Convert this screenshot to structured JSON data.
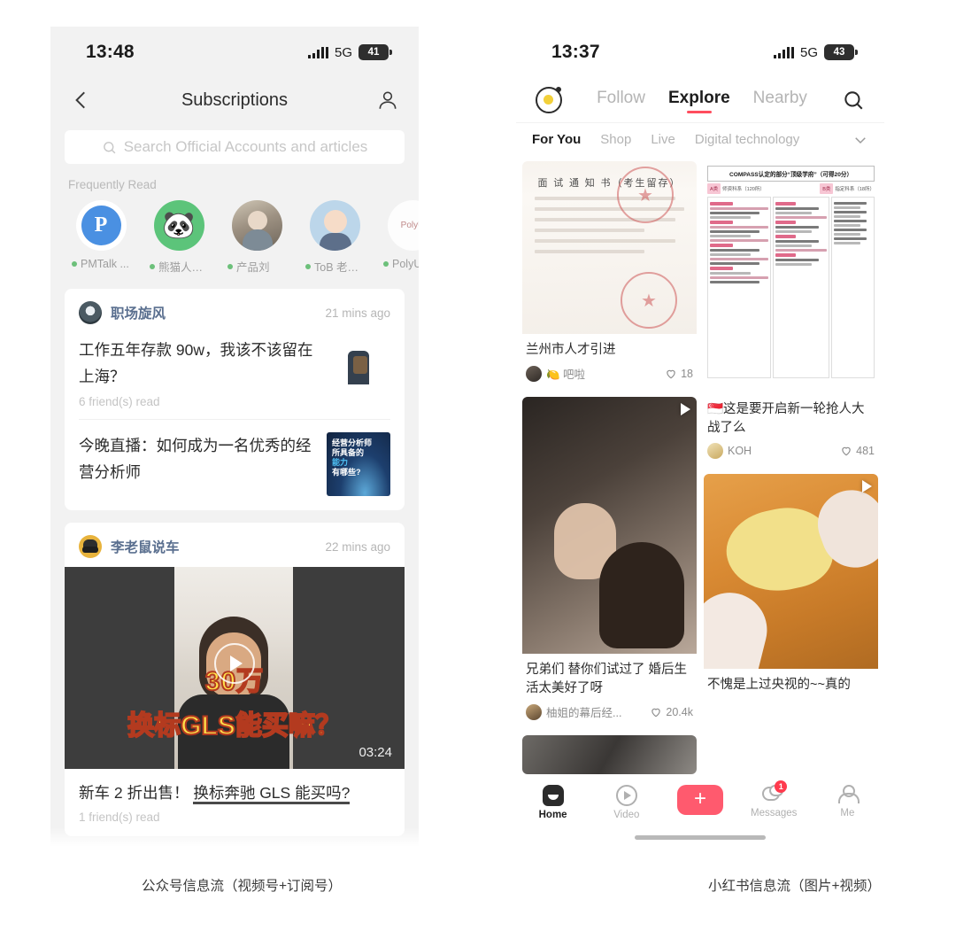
{
  "left_phone": {
    "status": {
      "time": "13:48",
      "network": "5G",
      "battery": "41"
    },
    "nav": {
      "title": "Subscriptions",
      "back_icon": "chevron-left-icon",
      "profile_icon": "person-icon"
    },
    "search": {
      "placeholder": "Search Official Accounts and articles",
      "icon": "search-icon"
    },
    "frequently_read": {
      "label": "Frequently Read",
      "items": [
        {
          "name": "PMTalk ...",
          "avatar": "pmtalk-logo"
        },
        {
          "name": "熊猫人运...",
          "avatar": "panda-logo"
        },
        {
          "name": "产品刘",
          "avatar": "woman-photo"
        },
        {
          "name": "ToB 老人家",
          "avatar": "man-illustration"
        },
        {
          "name": "PolyU",
          "avatar": "polyu-logo"
        }
      ]
    },
    "cards": [
      {
        "account": "职场旋风",
        "time": "21 mins ago",
        "articles": [
          {
            "title": "工作五年存款 90w，我该不该留在上海？",
            "sub": "6 friend(s) read",
            "thumb": "street-photo"
          },
          {
            "title": "今晚直播：如何成为一名优秀的经营分析师",
            "thumb": "live-poster",
            "thumb_text_1": "经营分析师",
            "thumb_text_2": "所具备的",
            "thumb_text_hl": "能力",
            "thumb_text_3": "有哪些?"
          }
        ]
      },
      {
        "account": "李老鼠说车",
        "time": "22 mins ago",
        "video": {
          "caption_line1": "30万",
          "caption_line2": "换标GLS能买嘛？",
          "duration": "03:24",
          "play_icon": "play-circle-icon"
        },
        "title_plain": "新车 2 折出售！ ",
        "title_underlined": "换标奔驰 GLS 能买吗?",
        "sub": "1 friend(s) read"
      }
    ]
  },
  "right_phone": {
    "status": {
      "time": "13:37",
      "network": "5G",
      "battery": "43"
    },
    "top": {
      "logo_icon": "xiaohongshu-logo-icon",
      "search_icon": "search-icon",
      "tabs": [
        {
          "label": "Follow",
          "active": false
        },
        {
          "label": "Explore",
          "active": true
        },
        {
          "label": "Nearby",
          "active": false
        }
      ]
    },
    "subtabs": {
      "items": [
        {
          "label": "For You",
          "active": true
        },
        {
          "label": "Shop",
          "active": false
        },
        {
          "label": "Live",
          "active": false
        },
        {
          "label": "Digital technology",
          "active": false
        }
      ],
      "chevron_icon": "chevron-down-icon"
    },
    "notes_left": [
      {
        "image": "interview-notice-document",
        "doc_title": "面 试 通 知 书（考生留存）",
        "title": "兰州市人才引进",
        "author": "🍋 吧啦",
        "likes": "18",
        "is_video": false
      },
      {
        "image": "couple-video",
        "title": "兄弟们 替你们试过了 婚后生活太美好了呀",
        "author": "柚姐的幕后经...",
        "likes": "20.4k",
        "is_video": true
      },
      {
        "image": "partial-video-thumb",
        "is_video": false
      }
    ],
    "notes_right": [
      {
        "image": "compass-ranking-table",
        "table_title": "COMPASS认定的部分“顶级学府”（可得20分）",
        "table_pill_1": "A类",
        "table_pill_1_note": "师资科系（120所）",
        "table_pill_2": "B类",
        "table_pill_2_note": "指定科系（18所）",
        "title": "🇸🇬这是要开启新一轮抢人大战了么",
        "author": "KOH",
        "likes": "481",
        "is_video": false
      },
      {
        "image": "fried-food-video",
        "title": "不愧是上过央视的~~真的",
        "is_video": true
      }
    ],
    "tabbar": [
      {
        "label": "Home",
        "icon": "home-icon",
        "active": true
      },
      {
        "label": "Video",
        "icon": "video-play-icon",
        "active": false
      },
      {
        "label": "",
        "icon": "plus-icon",
        "active": false,
        "symbol": "+"
      },
      {
        "label": "Messages",
        "icon": "messages-icon",
        "active": false,
        "badge": "1"
      },
      {
        "label": "Me",
        "icon": "person-icon",
        "active": false
      }
    ]
  },
  "captions": {
    "left": "公众号信息流（视频号+订阅号）",
    "right": "小红书信息流（图片+视频）"
  },
  "colors": {
    "accent_red": "#ff4d5e",
    "wechat_green": "#6cc07a",
    "link_blue": "#5a6f8f"
  }
}
